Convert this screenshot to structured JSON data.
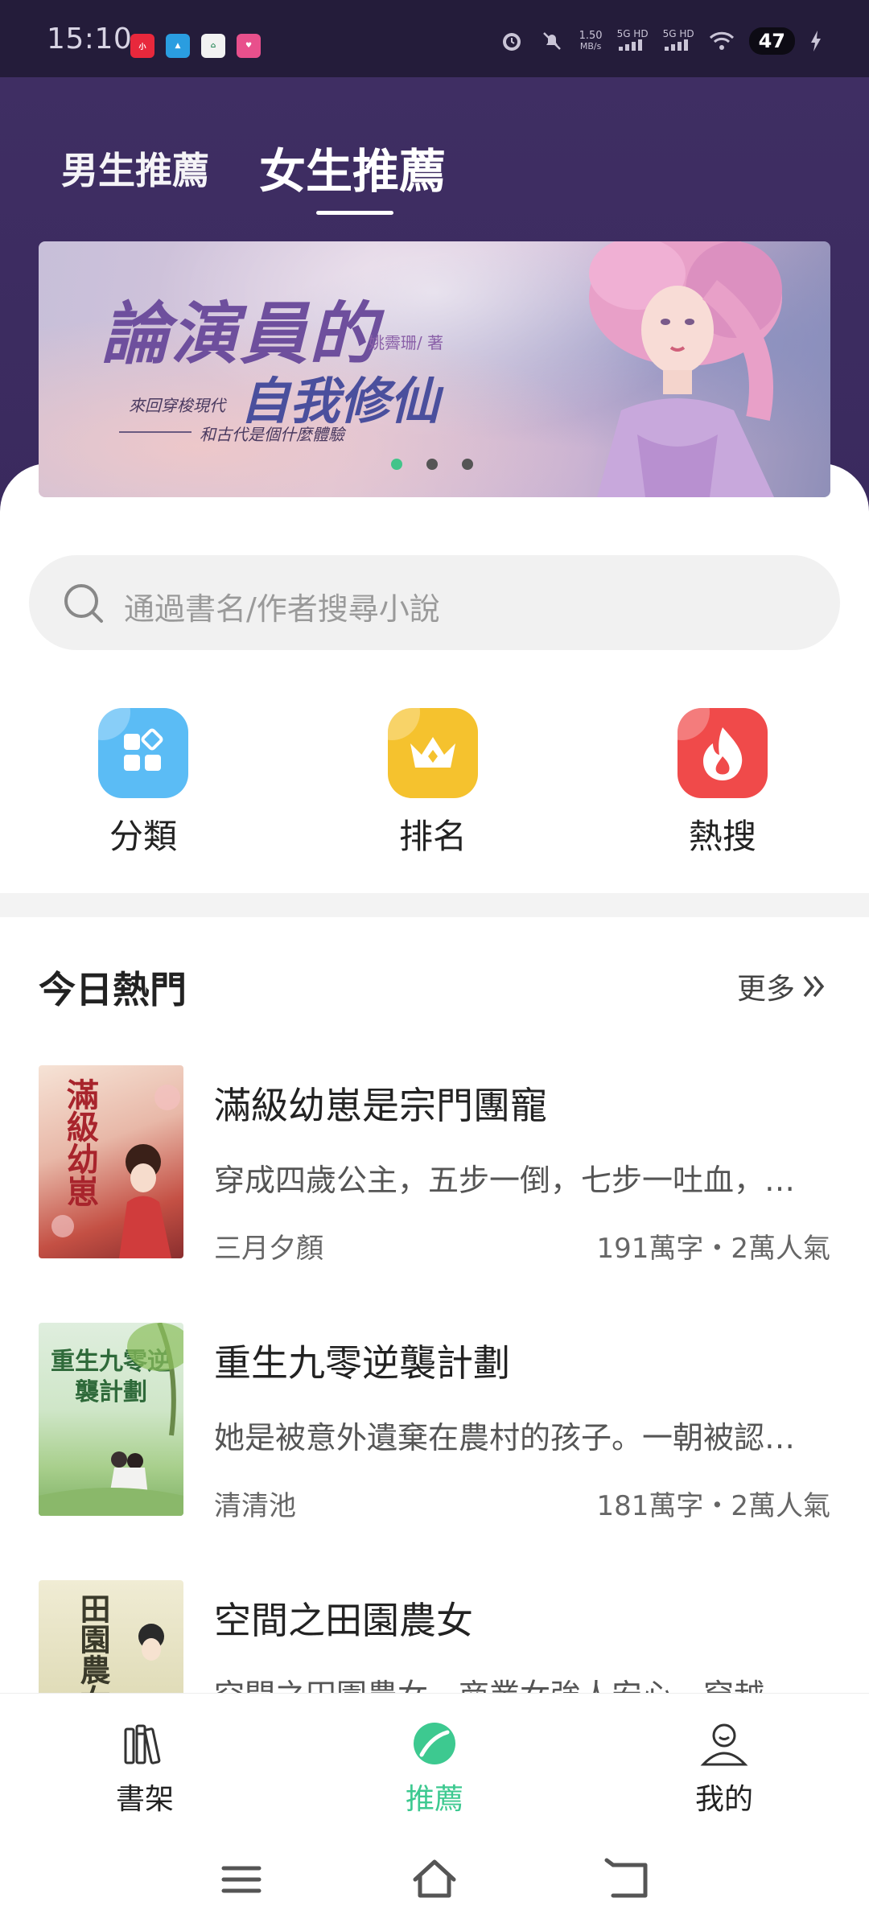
{
  "status_bar": {
    "time": "15:10",
    "net_speed": "1.50",
    "net_unit": "MB/s",
    "sim1": "5G HD",
    "sim2": "5G HD",
    "battery": "47"
  },
  "header": {
    "tabs": [
      {
        "label": "男生推薦",
        "active": false
      },
      {
        "label": "女生推薦",
        "active": true
      }
    ]
  },
  "banner": {
    "title_line1": "論演員的",
    "title_line2": "自我修仙",
    "author": "姚霽珊/ 著",
    "subtitle_line1": "來回穿梭現代",
    "subtitle_line2": "和古代是個什麼體驗",
    "page_count": 3,
    "active_index": 0
  },
  "search": {
    "placeholder": "通過書名/作者搜尋小說"
  },
  "quick_nav": [
    {
      "label": "分類",
      "icon": "category-grid-icon",
      "color": "#5bbcf5"
    },
    {
      "label": "排名",
      "icon": "crown-icon",
      "color": "#f5c22e"
    },
    {
      "label": "熱搜",
      "icon": "flame-icon",
      "color": "#f04a4a"
    }
  ],
  "section": {
    "title": "今日熱門",
    "more_label": "更多"
  },
  "books": [
    {
      "title": "滿級幼崽是宗門團寵",
      "description": "穿成四歲公主，五步一倒，七步一吐血，…",
      "author": "三月夕顏",
      "stats": "191萬字・2萬人氣",
      "cover_text": "滿級幼崽"
    },
    {
      "title": "重生九零逆襲計劃",
      "description": "她是被意外遺棄在農村的孩子。一朝被認…",
      "author": "清清池",
      "stats": "181萬字・2萬人氣",
      "cover_text": "重生九零逆襲計劃"
    },
    {
      "title": "空間之田園農女",
      "description": "空間之田園農女，商業女強人安心，穿越…",
      "author": "",
      "stats": "",
      "cover_text": "田園農女"
    }
  ],
  "bottom_nav": [
    {
      "label": "書架",
      "icon": "bookshelf-icon",
      "active": false
    },
    {
      "label": "推薦",
      "icon": "recommend-icon",
      "active": true
    },
    {
      "label": "我的",
      "icon": "profile-icon",
      "active": false
    }
  ],
  "colors": {
    "header_bg": "#3f2e63",
    "accent_green": "#3dc990",
    "status_bar_bg": "#241c3a"
  }
}
